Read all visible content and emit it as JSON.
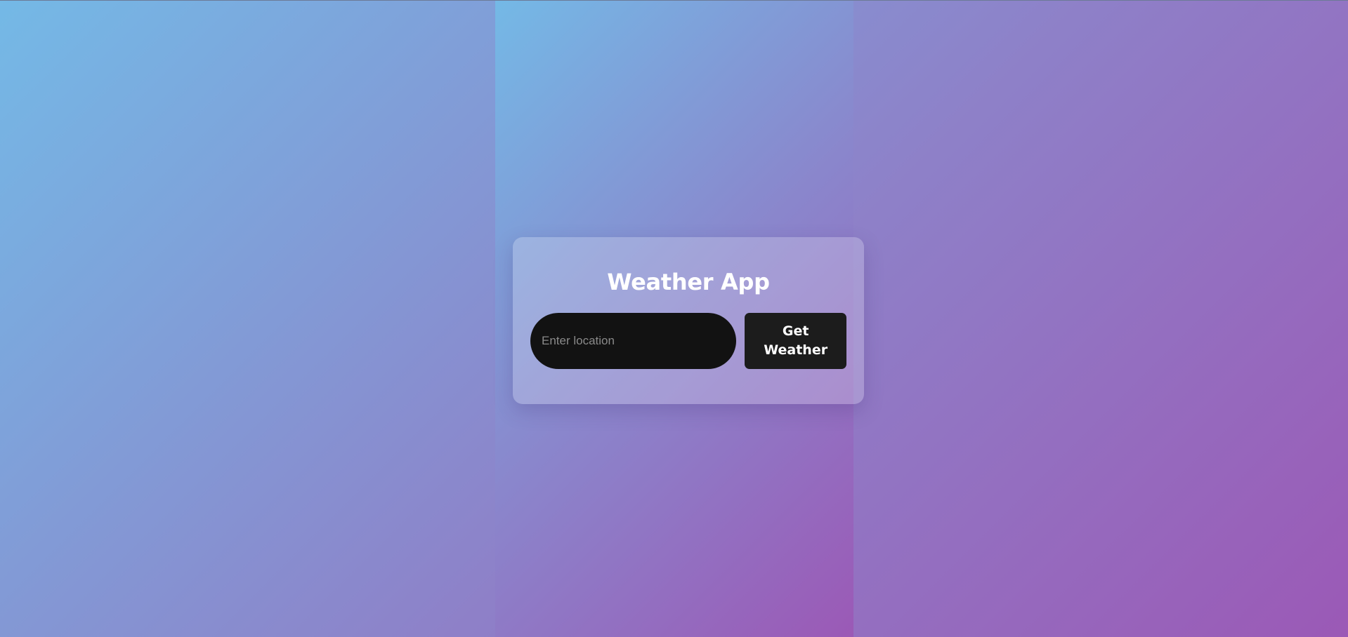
{
  "app": {
    "title": "Weather App"
  },
  "search": {
    "placeholder": "Enter location",
    "value": ""
  },
  "actions": {
    "get_weather_label": "Get Weather"
  },
  "colors": {
    "gradient_start": "#74b9e6",
    "gradient_end": "#9b59b6",
    "input_bg": "#121212",
    "button_bg": "#1c1c1c",
    "text": "#ffffff"
  }
}
